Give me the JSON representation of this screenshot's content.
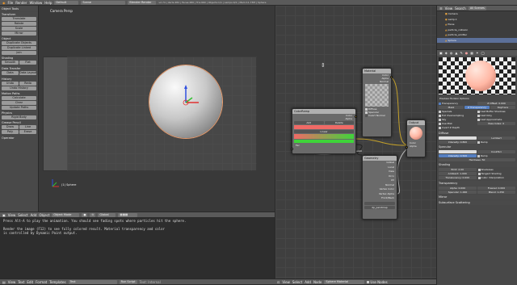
{
  "topbar": {
    "menus": [
      "File",
      "Render",
      "Window",
      "Help"
    ],
    "layout": "Default",
    "scene": "Scene",
    "engine": "Blender Render",
    "stats": "v2.74 | Verts:482 | Faces:480 | Tris:960 | Objects:1/1 | Lamps:0/1 | Mem:11.73M | Sphere"
  },
  "toolshelf": {
    "title": "Object Tools",
    "transform_header": "Transform",
    "transform": [
      "Translate",
      "Rotate",
      "Scale",
      "Mirror"
    ],
    "object_header": "Object",
    "object": [
      "Duplicate Objects",
      "Duplicate Linked",
      "Join"
    ],
    "shading_header": "Shading",
    "shading": [
      "Smooth",
      "Flat"
    ],
    "data_header": "Data Transfer",
    "data": [
      "Data",
      "Data Layout"
    ],
    "history_header": "History",
    "history": [
      "Undo",
      "Redo",
      "Undo History"
    ],
    "motion_header": "Motion Paths",
    "motion": [
      "Calculate",
      "Clear",
      "Update Paths"
    ],
    "physics_header": "Physics",
    "physics": [
      "Rigid Body"
    ],
    "grease_header": "Grease Pencil",
    "grease": [
      "Draw",
      "Line",
      "Poly",
      "Erase"
    ],
    "operator": "Operator"
  },
  "viewport": {
    "label": "Camera Persp",
    "object_label": "(1) Sphere",
    "menus": [
      "View",
      "Select",
      "Add",
      "Object"
    ],
    "mode": "Object Mode",
    "pivot": "Global"
  },
  "console": {
    "lines": [
      "Press Alt-A to play the animation. You should see fading spots where particles hit the sphere.",
      "Render the image (F12) to see fully colored result. Material transparency and color",
      "is controlled by Dynamic Paint output."
    ],
    "menus": [
      "View",
      "Text",
      "Edit",
      "Format",
      "Templates"
    ],
    "file": "Text",
    "run": "Run Script",
    "status": "Text: Internal"
  },
  "nodes": {
    "colorramp": {
      "title": "ColorRamp",
      "add": "Add",
      "delete": "Delete",
      "interp": "Linear",
      "out_color": "Color",
      "out_alpha": "Alpha",
      "in_fac": "Fac"
    },
    "material": {
      "title": "Material",
      "options": [
        "Diffuse",
        "Specular",
        "Invert Normal"
      ],
      "out": [
        "Color",
        "Alpha",
        "Normal"
      ]
    },
    "geometry": {
      "title": "Geometry",
      "outputs": [
        "Global",
        "Local",
        "View",
        "Orco",
        "UV",
        "Normal",
        "Vertex Color",
        "Vertex Alpha",
        "Front/Back"
      ],
      "uv": "",
      "vc": "dp_paintmap"
    },
    "output": {
      "title": "Output",
      "inputs": [
        "Color",
        "Alpha"
      ]
    },
    "menus": [
      "View",
      "Select",
      "Add",
      "Node"
    ],
    "material_name": "Sphere Material",
    "use_nodes": "Use Nodes"
  },
  "outliner": {
    "items": [
      "Camera",
      "Lamp.1",
      "Plane",
      "particle_collision",
      "particle_emitter",
      "Sphere"
    ],
    "filter": "All Scenes"
  },
  "properties": {
    "preview_label": "Preview Horizon Options",
    "transparency_label": "Transparency",
    "z_offset": "Z Offset: 0.000",
    "tabs": [
      "Mask",
      "Z Transparency",
      "Raytrace"
    ],
    "mat_opts": [
      "Specials",
      "Full Oversampling",
      "Sky",
      "Use Mist",
      "Invert Z Depth"
    ],
    "mat_opts_r": [
      "Cast Buffer Shadows",
      "Cast Only",
      "Cast Approximate",
      "Pass Index: 0"
    ],
    "diffuse_header": "Diffuse",
    "lambert": "Lambert",
    "intensity": "Intensity: 0.800",
    "ramp": "Ramp",
    "specular_header": "Specular",
    "cooktorr": "CookTorr",
    "spec_int": "Intensity: 0.500",
    "hardness": "Hardness: 50",
    "shading_header": "Shading",
    "emit": "Emit: 2.00",
    "ambient": "Ambient: 1.000",
    "translucency": "Translucency: 0.000",
    "shade_opts": [
      "Shadeless",
      "Tangent Shading",
      "Cubic Interpolation"
    ],
    "transparency_header": "Transparency",
    "alpha": "Alpha: 0.000",
    "fresnel": "Fresnel: 0.000",
    "specular_t": "Specular: 1.000",
    "blend": "Blend: 1.250",
    "mirror": "Mirror",
    "sss": "Subsurface Scattering",
    "menus": [
      "View",
      "Select",
      "Add",
      "Node"
    ]
  },
  "colors": {
    "ramp_start": "#f06a66",
    "ramp_end": "#3fd43a",
    "accent": "#5680c2",
    "sphere": "#ffb7a4"
  }
}
